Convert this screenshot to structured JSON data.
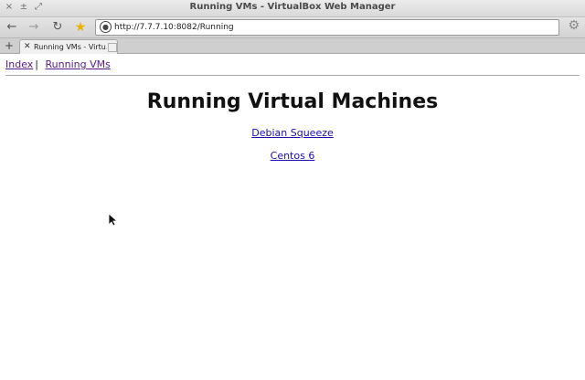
{
  "window": {
    "title": "Running VMs - VirtualBox Web Manager",
    "buttons": [
      "×",
      "±",
      "⤢"
    ]
  },
  "toolbar": {
    "back_icon": "←",
    "forward_icon": "→",
    "reload_icon": "↻",
    "bookmark_icon": "★",
    "url": "http://7.7.7.10:8082/Running",
    "settings_icon": "⚙"
  },
  "tabs": {
    "new_tab_label": "+",
    "items": [
      {
        "close": "✕",
        "label": "Running VMs - Virtu..."
      }
    ]
  },
  "page": {
    "nav": [
      {
        "label": "Index"
      },
      {
        "label": "Running VMs"
      }
    ],
    "separator": "|",
    "heading": "Running Virtual Machines",
    "vms": [
      {
        "label": "Debian Squeeze"
      },
      {
        "label": "Centos 6"
      }
    ]
  }
}
